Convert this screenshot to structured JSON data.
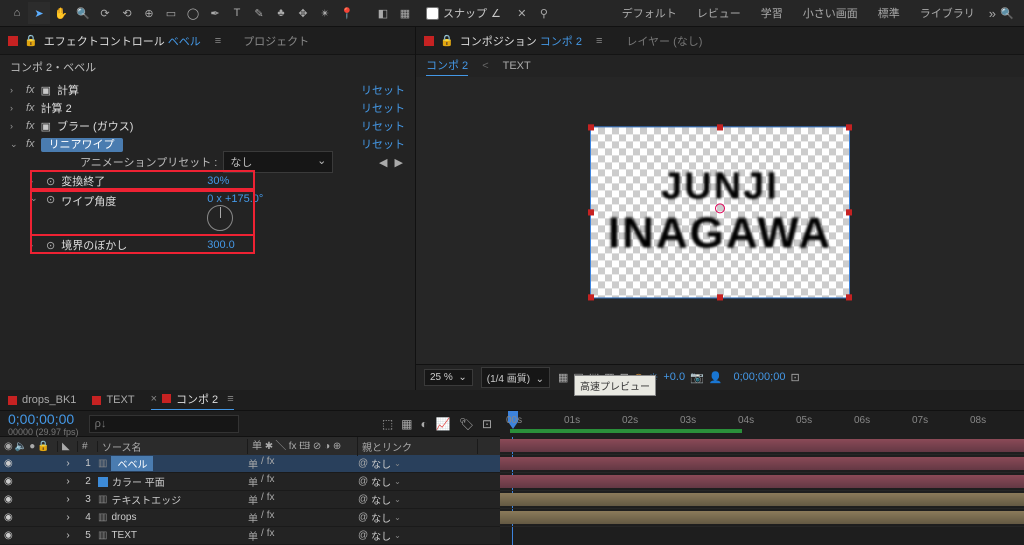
{
  "toolbar": {
    "snap_label": "スナップ",
    "menus": [
      "デフォルト",
      "レビュー",
      "学習",
      "小さい画面",
      "標準",
      "ライブラリ"
    ]
  },
  "effects_panel": {
    "tab_prefix": "エフェクトコントロール",
    "tab_suffix": "ベベル",
    "project_tab": "プロジェクト",
    "breadcrumb": "コンポ 2・ベベル",
    "effects": [
      {
        "name": "計算",
        "reset": "リセット"
      },
      {
        "name": "計算 2",
        "reset": "リセット"
      },
      {
        "name": "ブラー (ガウス)",
        "reset": "リセット"
      },
      {
        "name": "リニアワイプ",
        "reset": "リセット",
        "selected": true
      }
    ],
    "preset_label": "アニメーションプリセット :",
    "preset_value": "なし",
    "props": [
      {
        "name": "変換終了",
        "value": "30%"
      },
      {
        "name": "ワイプ角度",
        "value": "0 x +175.0°",
        "hasDial": true
      },
      {
        "name": "境界のぼかし",
        "value": "300.0"
      }
    ]
  },
  "comp_panel": {
    "tab_prefix": "コンポジション",
    "tab_link": "コンポ 2",
    "tab_dim": "レイヤー  (なし)",
    "crumb_active": "コンポ 2",
    "crumb2": "TEXT",
    "text_line1": "JUNJI",
    "text_line2": "INAGAWA",
    "tooltip": "高速プレビュー"
  },
  "viewer_bar": {
    "zoom": "25 %",
    "res": "(1/4 画質)",
    "exposure": "+0.0",
    "timecode": "0;00;00;00"
  },
  "timeline": {
    "tabs": [
      {
        "label": "drops_BK1"
      },
      {
        "label": "TEXT"
      },
      {
        "label": "コンポ 2",
        "active": true
      }
    ],
    "timecode": "0;00;00;00",
    "framerate": "00000 (29.97 fps)",
    "search_placeholder": "ρ↓",
    "header": {
      "num": "#",
      "source": "ソース名",
      "modes": "单 ✱ ╲ fx 🖽 ⊘ ◑ ⊕",
      "parent": "親とリンク"
    },
    "ruler": [
      "00s",
      "01s",
      "02s",
      "03s",
      "04s",
      "05s",
      "06s",
      "07s",
      "08s"
    ],
    "layers": [
      {
        "num": "1",
        "color": "#c2443a",
        "name": "ベベル",
        "selected": true,
        "none": "なし"
      },
      {
        "num": "2",
        "color": "#c2443a",
        "name": "カラー 平面",
        "icon": "#3d8bd8",
        "none": "なし"
      },
      {
        "num": "3",
        "color": "#c2443a",
        "name": "テキストエッジ",
        "none": "なし"
      },
      {
        "num": "4",
        "color": "#b7a06b",
        "name": "drops",
        "none": "なし"
      },
      {
        "num": "5",
        "color": "#b7a06b",
        "name": "TEXT",
        "none": "なし"
      }
    ]
  }
}
